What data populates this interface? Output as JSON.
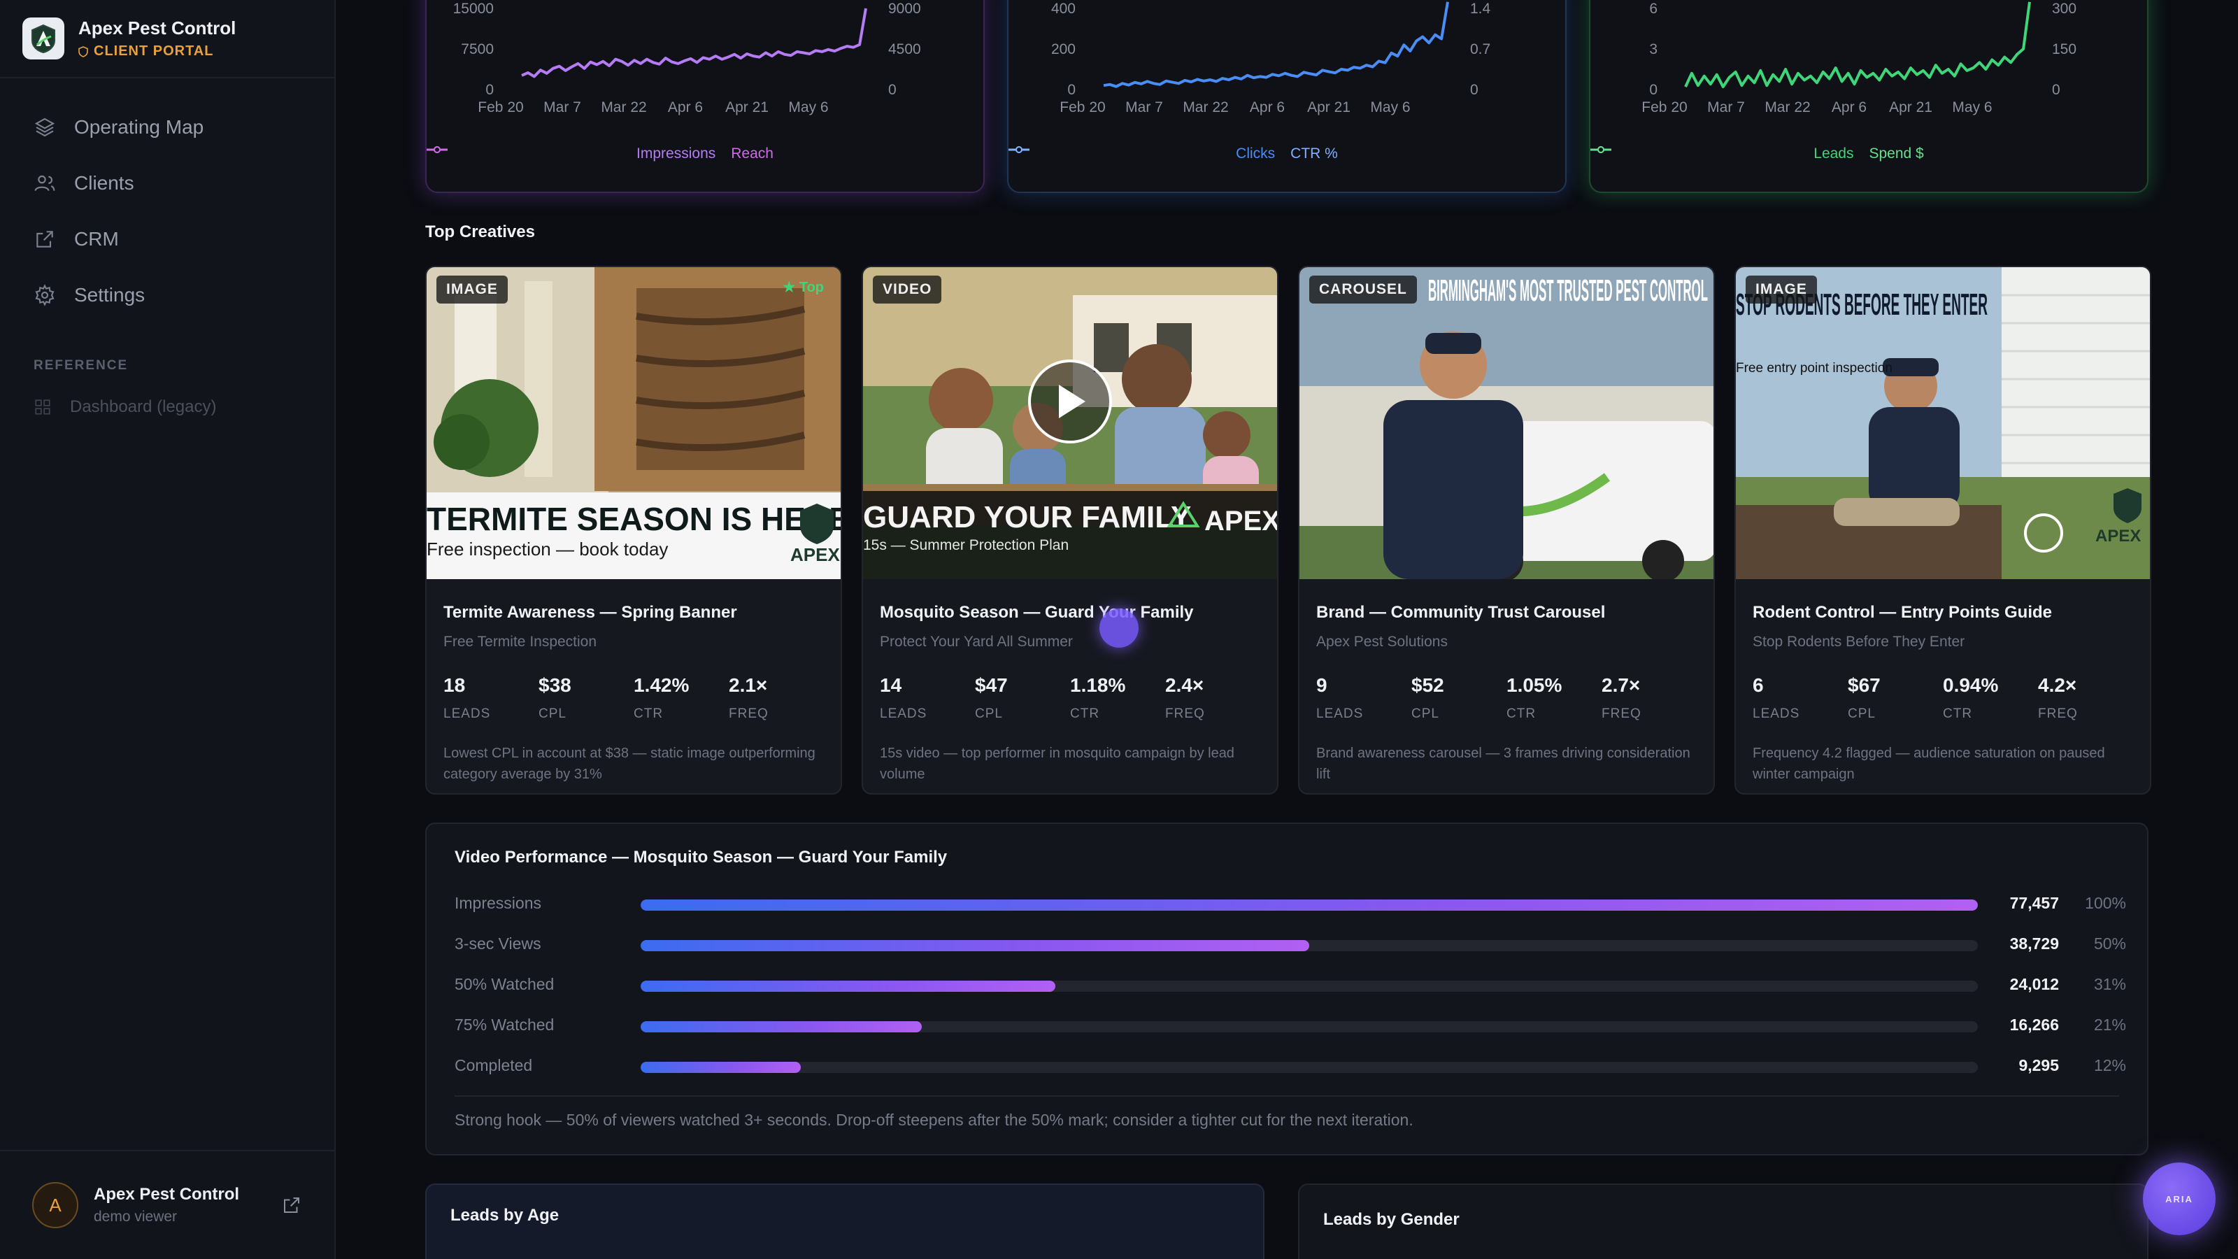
{
  "brand": {
    "name": "Apex Pest Control",
    "sub": "CLIENT PORTAL"
  },
  "nav": {
    "items": [
      {
        "label": "Operating Map",
        "icon": "layers-icon"
      },
      {
        "label": "Clients",
        "icon": "users-icon"
      },
      {
        "label": "CRM",
        "icon": "external-link-icon"
      },
      {
        "label": "Settings",
        "icon": "gear-icon"
      }
    ],
    "section": "REFERENCE",
    "legacy": "Dashboard (legacy)"
  },
  "footer": {
    "initial": "A",
    "name": "Apex Pest Control",
    "role": "demo viewer"
  },
  "charts": [
    {
      "id": "impressions",
      "color": "#b57cf6",
      "y_left_ticks": [
        "15000",
        "7500",
        "0"
      ],
      "y_right_ticks": [
        "9000",
        "4500",
        "0"
      ],
      "x_ticks": [
        "Feb 20",
        "Mar 7",
        "Mar 22",
        "Apr 6",
        "Apr 21",
        "May 6"
      ],
      "legend": [
        "Impressions",
        "Reach"
      ],
      "series_a": [
        2600,
        3100,
        2400,
        3600,
        3000,
        3900,
        4300,
        3500,
        4200,
        4800,
        3900,
        5100,
        4600,
        5200,
        4400,
        5600,
        5200,
        4500,
        5400,
        4800,
        5600,
        5000,
        4700,
        5800,
        5100,
        4800,
        5300,
        5700,
        5000,
        5900,
        5600,
        6200,
        5600,
        6000,
        6500,
        5800,
        6600,
        6200,
        6000,
        6800,
        6200,
        7000,
        6500,
        6300,
        7000,
        6800,
        6600,
        7200,
        7000,
        7400,
        7100,
        7600,
        8000,
        7800,
        8300,
        15000
      ]
    },
    {
      "id": "clicks",
      "color": "#4a8df5",
      "y_left_ticks": [
        "400",
        "200",
        "0"
      ],
      "y_right_ticks": [
        "1.4",
        "0.7",
        "0"
      ],
      "x_ticks": [
        "Feb 20",
        "Mar 7",
        "Mar 22",
        "Apr 6",
        "Apr 21",
        "May 6"
      ],
      "legend": [
        "Clicks",
        "CTR %"
      ],
      "series_a": [
        20,
        25,
        15,
        30,
        22,
        35,
        28,
        40,
        30,
        25,
        42,
        36,
        30,
        45,
        38,
        50,
        42,
        48,
        40,
        55,
        48,
        60,
        52,
        70,
        58,
        64,
        60,
        75,
        68,
        80,
        70,
        64,
        85,
        78,
        72,
        95,
        88,
        82,
        100,
        95,
        110,
        105,
        120,
        112,
        140,
        132,
        180,
        165,
        220,
        190,
        240,
        260,
        230,
        270,
        250,
        450
      ]
    },
    {
      "id": "leads",
      "color": "#3fd67a",
      "y_left_ticks": [
        "6",
        "3",
        "0"
      ],
      "y_right_ticks": [
        "300",
        "150",
        "0"
      ],
      "x_ticks": [
        "Feb 20",
        "Mar 7",
        "Mar 22",
        "Apr 6",
        "Apr 21",
        "May 6"
      ],
      "legend": [
        "Leads",
        "Spend $"
      ],
      "series_a": [
        0.2,
        1.2,
        0.3,
        1.0,
        0.4,
        1.1,
        0.2,
        0.9,
        1.3,
        0.3,
        1.0,
        0.5,
        1.4,
        0.3,
        1.1,
        0.6,
        1.5,
        0.4,
        1.2,
        0.7,
        1.0,
        0.5,
        1.3,
        0.8,
        1.6,
        0.6,
        1.2,
        0.4,
        1.4,
        0.9,
        1.2,
        0.7,
        1.5,
        1.0,
        1.3,
        0.8,
        1.6,
        1.1,
        1.4,
        0.9,
        1.8,
        1.2,
        1.5,
        1.0,
        1.9,
        1.4,
        1.6,
        2.0,
        1.5,
        2.2,
        1.8,
        2.4,
        2.0,
        2.6,
        3.0,
        6.8
      ]
    }
  ],
  "top_creatives_title": "Top Creatives",
  "creatives": [
    {
      "type": "IMAGE",
      "badge_top": "★ Top",
      "overlay_headline": "TERMITE SEASON IS HERE",
      "overlay_sub": "Free inspection — book today",
      "title": "Termite Awareness — Spring Banner",
      "subtitle": "Free Termite Inspection",
      "metrics": [
        {
          "v": "18",
          "l": "LEADS"
        },
        {
          "v": "$38",
          "l": "CPL"
        },
        {
          "v": "1.42%",
          "l": "CTR"
        },
        {
          "v": "2.1×",
          "l": "FREQ"
        }
      ],
      "note": "Lowest CPL in account at $38 — static image outperforming category average by 31%"
    },
    {
      "type": "VIDEO",
      "overlay_headline": "GUARD YOUR FAMILY",
      "overlay_sub": "15s — Summer Protection Plan",
      "title": "Mosquito Season — Guard Your Family",
      "subtitle": "Protect Your Yard All Summer",
      "metrics": [
        {
          "v": "14",
          "l": "LEADS"
        },
        {
          "v": "$47",
          "l": "CPL"
        },
        {
          "v": "1.18%",
          "l": "CTR"
        },
        {
          "v": "2.4×",
          "l": "FREQ"
        }
      ],
      "note": "15s video — top performer in mosquito campaign by lead volume"
    },
    {
      "type": "CAROUSEL",
      "overlay_headline": "BIRMINGHAM'S MOST TRUSTED PEST CONTROL",
      "title": "Brand — Community Trust Carousel",
      "subtitle": "Apex Pest Solutions",
      "metrics": [
        {
          "v": "9",
          "l": "LEADS"
        },
        {
          "v": "$52",
          "l": "CPL"
        },
        {
          "v": "1.05%",
          "l": "CTR"
        },
        {
          "v": "2.7×",
          "l": "FREQ"
        }
      ],
      "note": "Brand awareness carousel — 3 frames driving consideration lift"
    },
    {
      "type": "IMAGE",
      "overlay_headline": "STOP RODENTS BEFORE THEY ENTER",
      "overlay_sub": "Free entry point inspection",
      "title": "Rodent Control — Entry Points Guide",
      "subtitle": "Stop Rodents Before They Enter",
      "metrics": [
        {
          "v": "6",
          "l": "LEADS"
        },
        {
          "v": "$67",
          "l": "CPL"
        },
        {
          "v": "0.94%",
          "l": "CTR"
        },
        {
          "v": "4.2×",
          "l": "FREQ"
        }
      ],
      "note": "Frequency 4.2 flagged — audience saturation on paused winter campaign"
    }
  ],
  "video": {
    "title": "Video Performance — Mosquito Season — Guard Your Family",
    "rows": [
      {
        "label": "Impressions",
        "value": "77,457",
        "pct": "100%",
        "frac": 1.0
      },
      {
        "label": "3-sec Views",
        "value": "38,729",
        "pct": "50%",
        "frac": 0.5
      },
      {
        "label": "50% Watched",
        "value": "24,012",
        "pct": "31%",
        "frac": 0.31
      },
      {
        "label": "75% Watched",
        "value": "16,266",
        "pct": "21%",
        "frac": 0.21
      },
      {
        "label": "Completed",
        "value": "9,295",
        "pct": "12%",
        "frac": 0.12
      }
    ],
    "note": "Strong hook — 50% of viewers watched 3+ seconds. Drop-off steepens after the 50% mark; consider a tighter cut for the next iteration."
  },
  "bottom": {
    "age_title": "Leads by Age",
    "gender_title": "Leads by Gender"
  },
  "aria": "ARIA"
}
